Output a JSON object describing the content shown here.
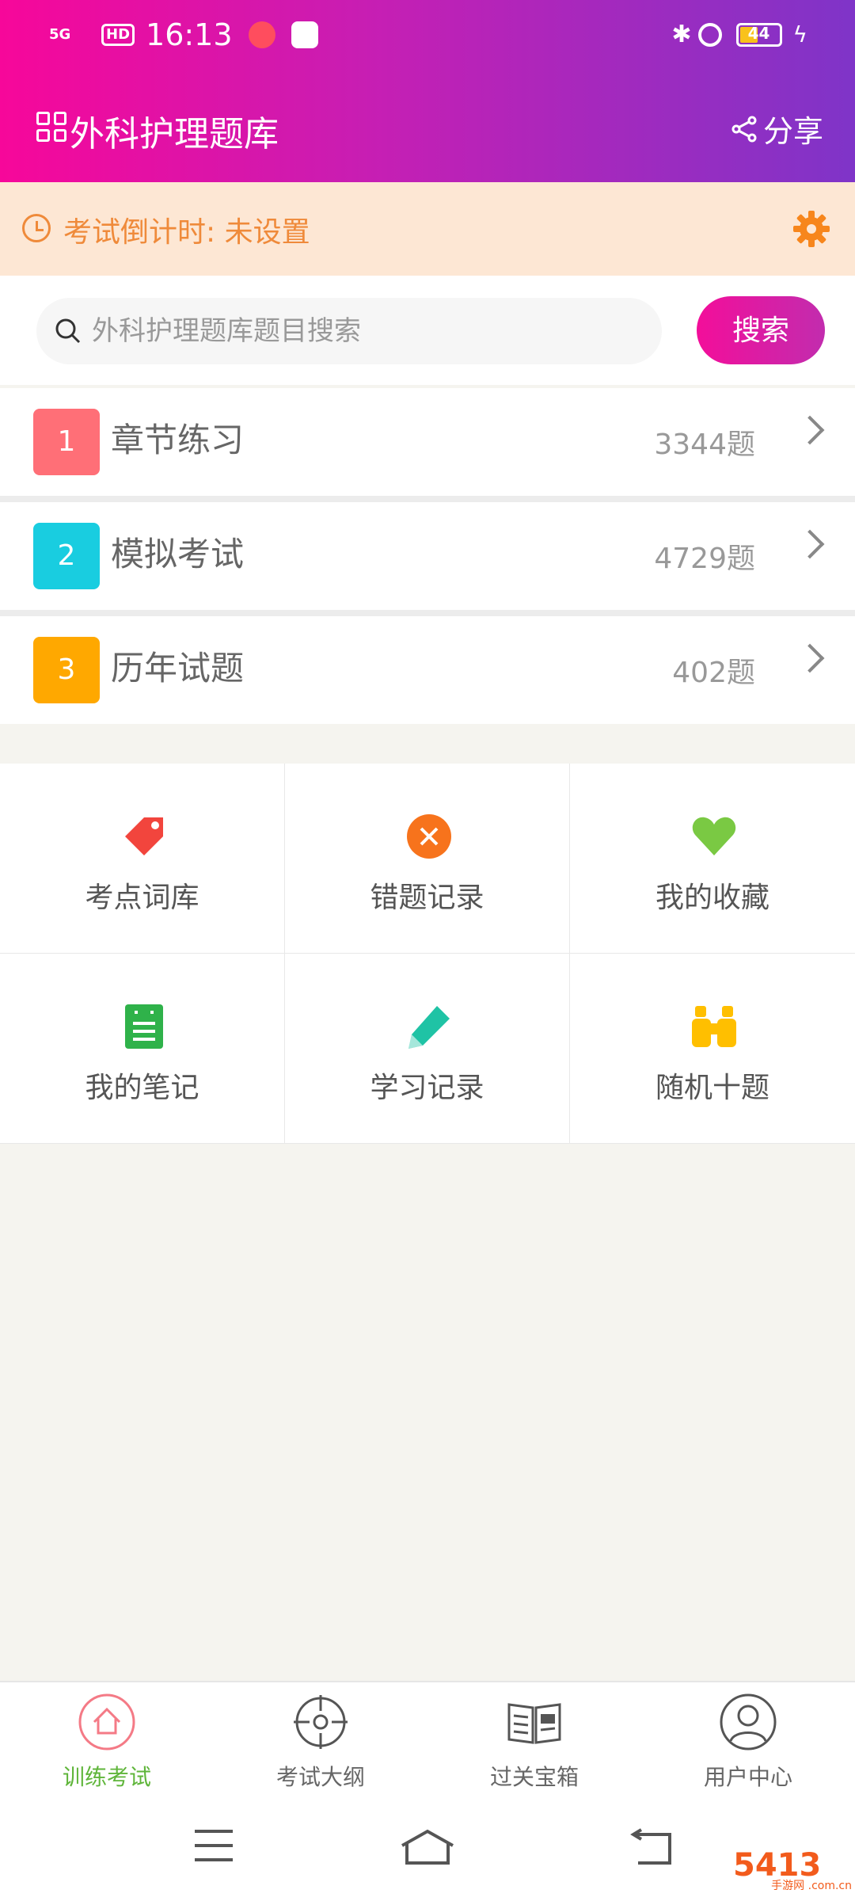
{
  "status_bar": {
    "signal": "5G",
    "hd": "HD",
    "time": "16:13",
    "battery": "44"
  },
  "app": {
    "title": "外科护理题库",
    "share_label": "分享"
  },
  "countdown": {
    "text": "考试倒计时: 未设置"
  },
  "search": {
    "placeholder": "外科护理题库题目搜索",
    "button": "搜索"
  },
  "sections": [
    {
      "num": "1",
      "label": "章节练习",
      "count": "3344题",
      "color": "#ff6f77"
    },
    {
      "num": "2",
      "label": "模拟考试",
      "count": "4729题",
      "color": "#19cde0"
    },
    {
      "num": "3",
      "label": "历年试题",
      "count": "402题",
      "color": "#ffa800"
    }
  ],
  "tools": [
    {
      "label": "考点词库",
      "icon": "tag-icon",
      "color": "#f2453d"
    },
    {
      "label": "错题记录",
      "icon": "close-circle-icon",
      "color": "#f7731c"
    },
    {
      "label": "我的收藏",
      "icon": "heart-icon",
      "color": "#7ac943"
    },
    {
      "label": "我的笔记",
      "icon": "note-icon",
      "color": "#2fb24a"
    },
    {
      "label": "学习记录",
      "icon": "pencil-icon",
      "color": "#1fc3a5"
    },
    {
      "label": "随机十题",
      "icon": "binoculars-icon",
      "color": "#ffbf00"
    }
  ],
  "tabs": [
    {
      "label": "训练考试",
      "icon": "home-icon",
      "active": true
    },
    {
      "label": "考试大纲",
      "icon": "target-icon",
      "active": false
    },
    {
      "label": "过关宝箱",
      "icon": "news-book-icon",
      "active": false
    },
    {
      "label": "用户中心",
      "icon": "user-icon",
      "active": false
    }
  ],
  "colors": {
    "accent_pink": "#f30e9a",
    "active_tab": "#5fb53a",
    "countdown_orange": "#ef8a3a"
  },
  "watermark": {
    "main": "5413",
    "sub": "手游网 .com.cn"
  }
}
